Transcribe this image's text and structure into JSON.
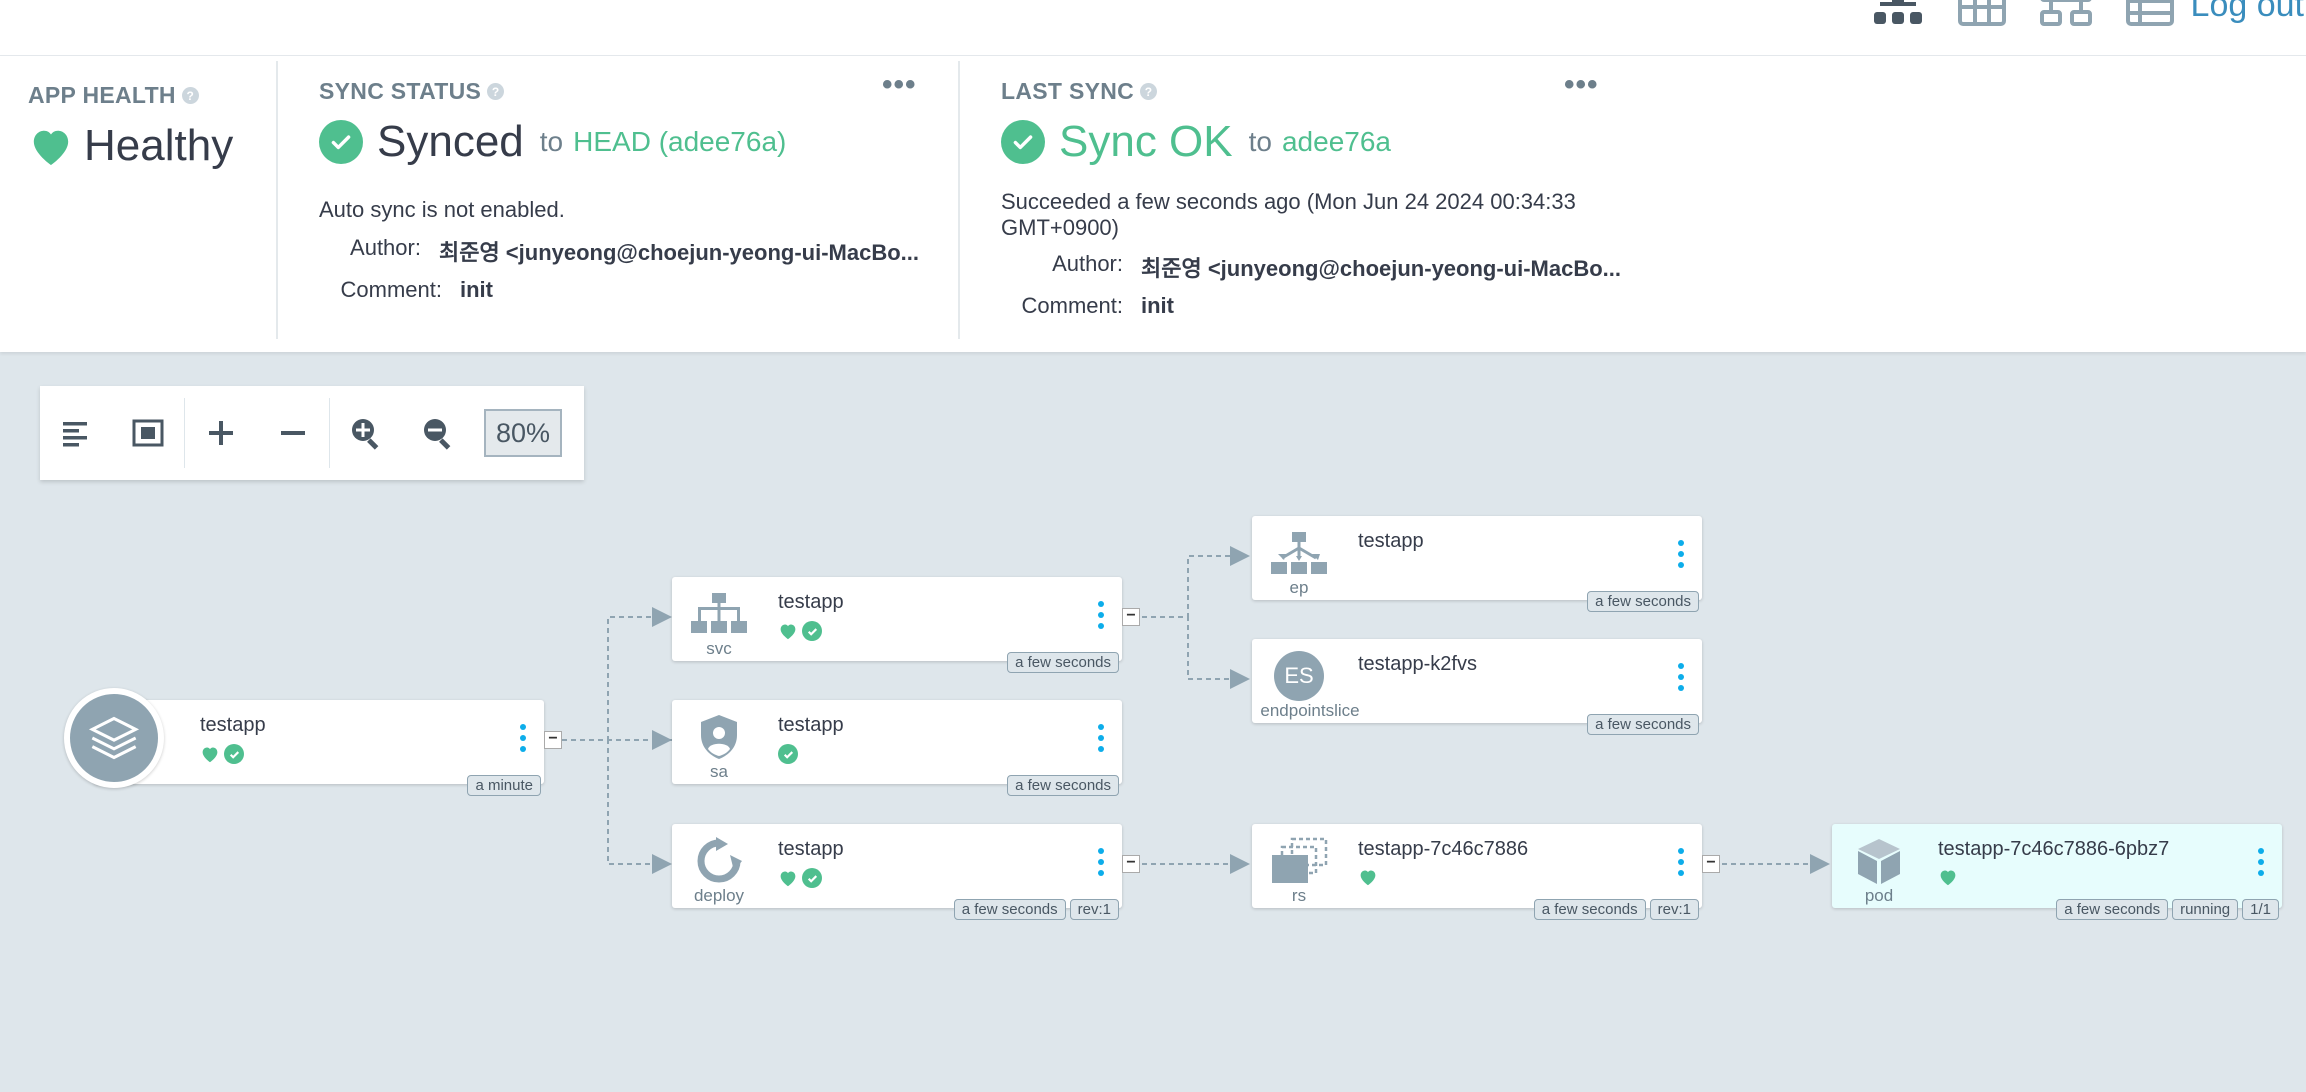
{
  "topbar": {
    "logout_label": "Log out",
    "views": [
      "tree-view-icon",
      "pods-view-icon",
      "network-view-icon",
      "list-view-icon"
    ]
  },
  "app_health": {
    "title": "APP HEALTH",
    "status": "Healthy",
    "color": "#4fbf8f"
  },
  "sync_status": {
    "title": "SYNC STATUS",
    "status": "Synced",
    "to_label": "to",
    "revision": "HEAD (adee76a)",
    "auto_sync": "Auto sync is not enabled.",
    "author_label": "Author:",
    "author": "최준영 <junyeong@choejun-yeong-ui-MacBo...",
    "comment_label": "Comment:",
    "comment": "init"
  },
  "last_sync": {
    "title": "LAST SYNC",
    "status": "Sync OK",
    "to_label": "to",
    "revision": "adee76a",
    "succeeded_line1": "Succeeded a few seconds ago (Mon Jun 24 2024 00:34:33",
    "succeeded_line2": "GMT+0900)",
    "author_label": "Author:",
    "author": "최준영 <junyeong@choejun-yeong-ui-MacBo...",
    "comment_label": "Comment:",
    "comment": "init"
  },
  "toolbar": {
    "zoom": "80%"
  },
  "graph": {
    "app": {
      "name": "testapp",
      "age": "a minute"
    },
    "svc": {
      "kind": "svc",
      "name": "testapp",
      "age": "a few seconds"
    },
    "sa": {
      "kind": "sa",
      "name": "testapp",
      "age": "a few seconds"
    },
    "deploy": {
      "kind": "deploy",
      "name": "testapp",
      "age": "a few seconds",
      "rev": "rev:1"
    },
    "ep": {
      "kind": "ep",
      "name": "testapp",
      "age": "a few seconds"
    },
    "es": {
      "kind": "endpointslice",
      "badge": "ES",
      "name": "testapp-k2fvs",
      "age": "a few seconds"
    },
    "rs": {
      "kind": "rs",
      "name": "testapp-7c46c7886",
      "age": "a few seconds",
      "rev": "rev:1"
    },
    "pod": {
      "kind": "pod",
      "name": "testapp-7c46c7886-6pbz7",
      "age": "a few seconds",
      "state": "running",
      "ready": "1/1"
    }
  },
  "colors": {
    "healthy": "#4fbf8f",
    "link": "#3a8dbd",
    "menu_dots": "#0dadea",
    "background": "#dee6eb"
  }
}
